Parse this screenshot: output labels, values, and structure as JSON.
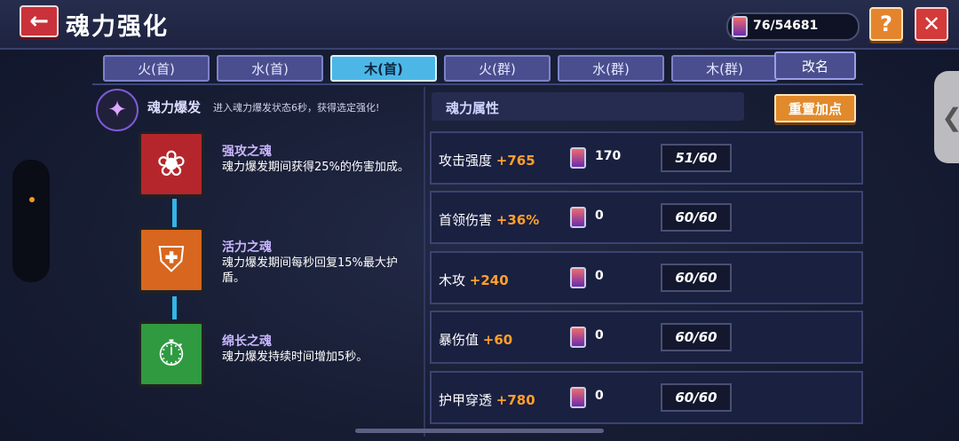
{
  "header": {
    "back_icon": "←",
    "title": "魂力强化",
    "currency": "76/54681",
    "help_label": "?",
    "close_label": "✕"
  },
  "tabs": [
    {
      "label": "火(首)",
      "active": false
    },
    {
      "label": "水(首)",
      "active": false
    },
    {
      "label": "木(首)",
      "active": true
    },
    {
      "label": "火(群)",
      "active": false
    },
    {
      "label": "水(群)",
      "active": false
    },
    {
      "label": "木(群)",
      "active": false
    }
  ],
  "rename_label": "改名",
  "burst": {
    "title": "魂力爆发",
    "desc": "进入魂力爆发状态6秒，获得选定强化!"
  },
  "skills": [
    {
      "name": "强攻之魂",
      "desc": "魂力爆发期间获得25%的伤害加成。",
      "icon": "red-flower-icon",
      "color": "#b5262c"
    },
    {
      "name": "活力之魂",
      "desc": "魂力爆发期间每秒回复15%最大护盾。",
      "icon": "shield-icon",
      "color": "#d8661e"
    },
    {
      "name": "绵长之魂",
      "desc": "魂力爆发持续时间增加5秒。",
      "icon": "clock-icon",
      "color": "#2f9a40"
    }
  ],
  "attributes_title": "魂力属性",
  "reset_label": "重置加点",
  "attributes": [
    {
      "name": "攻击强度",
      "bonus": "+765",
      "cost": "170",
      "level": "51/60"
    },
    {
      "name": "首领伤害",
      "bonus": "+36%",
      "cost": "0",
      "level": "60/60"
    },
    {
      "name": "木攻",
      "bonus": "+240",
      "cost": "0",
      "level": "60/60"
    },
    {
      "name": "暴伤值",
      "bonus": "+60",
      "cost": "0",
      "level": "60/60"
    },
    {
      "name": "护甲穿透",
      "bonus": "+780",
      "cost": "0",
      "level": "60/60"
    }
  ]
}
